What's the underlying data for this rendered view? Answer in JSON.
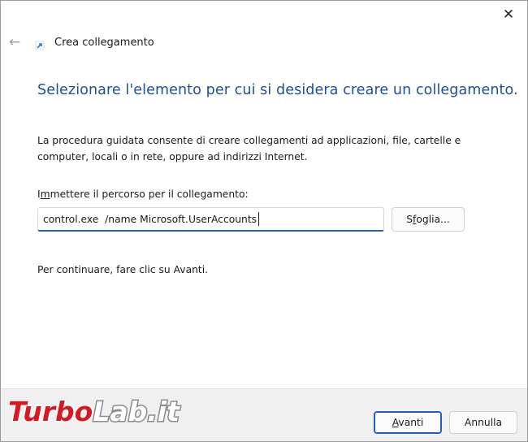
{
  "window": {
    "close_label": "✕"
  },
  "header": {
    "back_icon": "←",
    "icon": "shortcut-wizard-icon",
    "title": "Crea collegamento"
  },
  "main": {
    "heading": "Selezionare l'elemento per cui si desidera creare un collegamento.",
    "description": "La procedura guidata consente di creare collegamenti ad applicazioni, file, cartelle e computer, locali o in rete, oppure ad indirizzi Internet.",
    "path_label_prefix": "I",
    "path_label_accel": "m",
    "path_label_rest": "mettere il percorso per il collegamento:",
    "path_value": "control.exe  /name Microsoft.UserAccounts",
    "browse_prefix": "S",
    "browse_accel": "f",
    "browse_rest": "oglia...",
    "continue_text": "Per continuare, fare clic su Avanti."
  },
  "footer": {
    "next_accel": "A",
    "next_rest": "vanti",
    "cancel_label": "Annulla"
  },
  "watermark": {
    "text": "TurboLab.it"
  },
  "colors": {
    "heading": "#1f4e9d",
    "accent": "#1f5fbf",
    "watermark_red": "#d71920"
  }
}
